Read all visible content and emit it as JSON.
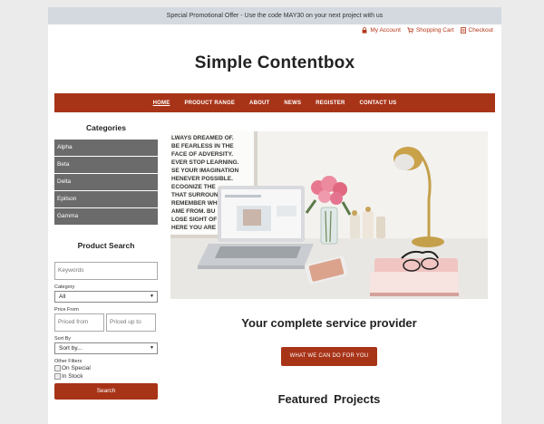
{
  "promo": {
    "text": "Special Promotional Offer - Use the code MAY30 on your next project with us"
  },
  "toplinks": [
    {
      "icon": "lock-icon",
      "label": "My Account"
    },
    {
      "icon": "cart-icon",
      "label": "Shopping Cart"
    },
    {
      "icon": "checkout-icon",
      "label": "Checkout"
    }
  ],
  "site": {
    "title": "Simple Contentbox"
  },
  "nav": [
    "HOME",
    "PRODUCT RANGE",
    "ABOUT",
    "NEWS",
    "REGISTER",
    "CONTACT US"
  ],
  "categories": {
    "heading": "Categories",
    "items": [
      "Alpha",
      "Beta",
      "Delta",
      "Epilson",
      "Gamma"
    ]
  },
  "product_search": {
    "heading": "Product Search",
    "keywords_placeholder": "Keywords",
    "category_label": "Category",
    "category_value": "All",
    "price_label": "Price From",
    "price_from_placeholder": "Priced from",
    "price_to_placeholder": "Priced up to",
    "sort_label": "Sort By",
    "sort_value": "Sort by...",
    "filters_label": "Other Filters",
    "filter_on_special": "On Special",
    "filter_in_stock": "In Stock",
    "search_button": "Search"
  },
  "hero": {
    "poster_lines": [
      "LWAYS DREAMED OF.",
      "BE FEARLESS IN THE",
      "FACE OF ADVERSITY.",
      "EVER STOP LEARNING.",
      "SE YOUR IMAGINATION",
      "HENEVER POSSIBLE.",
      "ECOGNIZE THE",
      "THAT SURROUND",
      "REMEMBER WHE",
      "AME FROM. BU",
      "LOSE SIGHT OF",
      "HERE YOU ARE GO"
    ]
  },
  "main": {
    "tagline": "Your complete service provider",
    "cta": "WHAT WE CAN DO FOR YOU",
    "featured": "Featured Projects"
  },
  "colors": {
    "accent": "#a83418",
    "category_bg": "#6b6b6b",
    "promo_bg": "#d3d9df"
  }
}
